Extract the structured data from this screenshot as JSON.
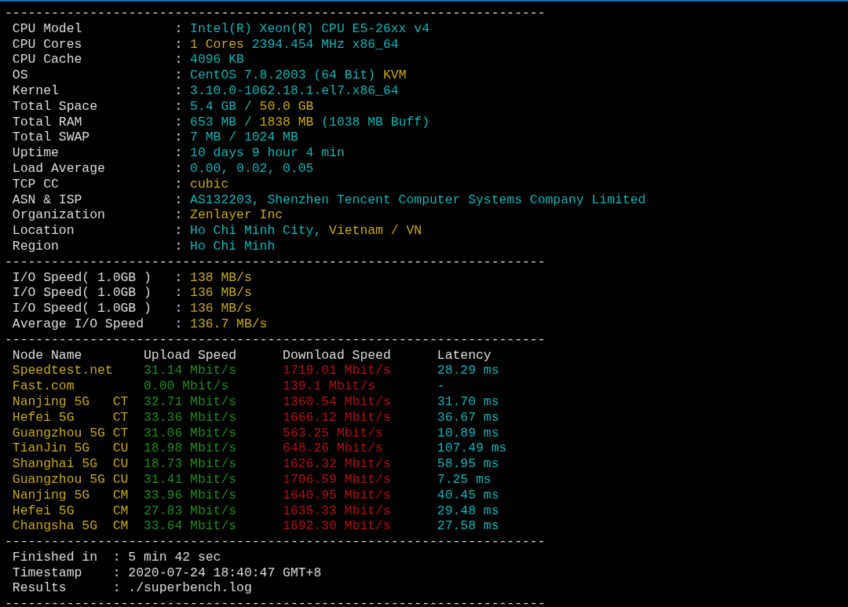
{
  "lines": [
    {
      "kind": "rule",
      "text": "----------------------------------------------------------------------"
    },
    {
      "kind": "field",
      "label": "CPU Model",
      "sep": ":",
      "parts": [
        {
          "text": "Intel(R) Xeon(R) CPU E5-26xx v4",
          "color": "#0fb3b8"
        }
      ]
    },
    {
      "kind": "field",
      "label": "CPU Cores",
      "sep": ":",
      "parts": [
        {
          "text": "1 Cores",
          "color": "#c8a80c"
        },
        {
          "text": "2394.454 MHz x86_64",
          "color": "#0fb3b8"
        }
      ]
    },
    {
      "kind": "field",
      "label": "CPU Cache",
      "sep": ":",
      "parts": [
        {
          "text": "4096 KB",
          "color": "#0fb3b8"
        }
      ]
    },
    {
      "kind": "field",
      "label": "OS",
      "sep": ":",
      "parts": [
        {
          "text": "CentOS 7.8.2003 (64 Bit)",
          "color": "#0fb3b8"
        },
        {
          "text": "KVM",
          "color": "#c8a80c"
        }
      ]
    },
    {
      "kind": "field",
      "label": "Kernel",
      "sep": ":",
      "parts": [
        {
          "text": "3.10.0-1062.18.1.el7.x86_64",
          "color": "#0fb3b8"
        }
      ]
    },
    {
      "kind": "field",
      "label": "Total Space",
      "sep": ":",
      "parts": [
        {
          "text": "5.4 GB /",
          "color": "#0fb3b8"
        },
        {
          "text": "50.0 GB",
          "color": "#c8a80c"
        }
      ]
    },
    {
      "kind": "field",
      "label": "Total RAM",
      "sep": ":",
      "parts": [
        {
          "text": "653 MB /",
          "color": "#0fb3b8"
        },
        {
          "text": "1838 MB",
          "color": "#c8a80c"
        },
        {
          "text": "(1038 MB Buff)",
          "color": "#0fb3b8"
        }
      ]
    },
    {
      "kind": "field",
      "label": "Total SWAP",
      "sep": ":",
      "parts": [
        {
          "text": "7 MB / 1024 MB",
          "color": "#0fb3b8"
        }
      ]
    },
    {
      "kind": "field",
      "label": "Uptime",
      "sep": ":",
      "parts": [
        {
          "text": "10 days 9 hour 4 min",
          "color": "#0fb3b8"
        }
      ]
    },
    {
      "kind": "field",
      "label": "Load Average",
      "sep": ":",
      "parts": [
        {
          "text": "0.00, 0.02, 0.05",
          "color": "#0fb3b8"
        }
      ]
    },
    {
      "kind": "field",
      "label": "TCP CC",
      "sep": ":",
      "parts": [
        {
          "text": "cubic",
          "color": "#c8a80c"
        }
      ]
    },
    {
      "kind": "field",
      "label": "ASN & ISP",
      "sep": ":",
      "parts": [
        {
          "text": "AS132203, Shenzhen Tencent Computer Systems Company Limited",
          "color": "#0fb3b8"
        }
      ]
    },
    {
      "kind": "field",
      "label": "Organization",
      "sep": ":",
      "parts": [
        {
          "text": "Zenlayer Inc",
          "color": "#c8a80c"
        }
      ]
    },
    {
      "kind": "field",
      "label": "Location",
      "sep": ":",
      "parts": [
        {
          "text": "Ho Chi Minh City,",
          "color": "#0fb3b8"
        },
        {
          "text": "Vietnam / VN",
          "color": "#c8a80c"
        }
      ]
    },
    {
      "kind": "field",
      "label": "Region",
      "sep": ":",
      "parts": [
        {
          "text": "Ho Chi Minh",
          "color": "#0fb3b8"
        }
      ]
    },
    {
      "kind": "rule",
      "text": "----------------------------------------------------------------------"
    },
    {
      "kind": "field",
      "label": "I/O Speed( 1.0GB )",
      "sep": ":",
      "parts": [
        {
          "text": "138 MB/s",
          "color": "#c8a80c"
        }
      ]
    },
    {
      "kind": "field",
      "label": "I/O Speed( 1.0GB )",
      "sep": ":",
      "parts": [
        {
          "text": "136 MB/s",
          "color": "#c8a80c"
        }
      ]
    },
    {
      "kind": "field",
      "label": "I/O Speed( 1.0GB )",
      "sep": ":",
      "parts": [
        {
          "text": "136 MB/s",
          "color": "#c8a80c"
        }
      ]
    },
    {
      "kind": "field",
      "label": "Average I/O Speed",
      "sep": ":",
      "parts": [
        {
          "text": "136.7 MB/s",
          "color": "#c8a80c"
        }
      ]
    },
    {
      "kind": "rule",
      "text": "----------------------------------------------------------------------"
    },
    {
      "kind": "header",
      "cells": [
        "Node Name",
        "Upload Speed",
        "Download Speed",
        "Latency"
      ]
    },
    {
      "kind": "speed",
      "cells": [
        "Speedtest.net",
        "31.14 Mbit/s",
        "1719.01 Mbit/s",
        "28.29 ms"
      ]
    },
    {
      "kind": "speed",
      "cells": [
        "Fast.com",
        "0.00 Mbit/s",
        "139.1 Mbit/s",
        "-"
      ]
    },
    {
      "kind": "speed",
      "cells": [
        "Nanjing 5G   CT",
        "32.71 Mbit/s",
        "1360.54 Mbit/s",
        "31.70 ms"
      ]
    },
    {
      "kind": "speed",
      "cells": [
        "Hefei 5G     CT",
        "33.36 Mbit/s",
        "1666.12 Mbit/s",
        "36.67 ms"
      ]
    },
    {
      "kind": "speed",
      "cells": [
        "Guangzhou 5G CT",
        "31.06 Mbit/s",
        "563.25 Mbit/s",
        "10.89 ms"
      ]
    },
    {
      "kind": "speed",
      "cells": [
        "TianJin 5G   CU",
        "18.98 Mbit/s",
        "648.26 Mbit/s",
        "107.49 ms"
      ]
    },
    {
      "kind": "speed",
      "cells": [
        "Shanghai 5G  CU",
        "18.73 Mbit/s",
        "1626.32 Mbit/s",
        "58.95 ms"
      ]
    },
    {
      "kind": "speed",
      "cells": [
        "Guangzhou 5G CU",
        "31.41 Mbit/s",
        "1706.59 Mbit/s",
        "7.25 ms"
      ]
    },
    {
      "kind": "speed",
      "cells": [
        "Nanjing 5G   CM",
        "33.96 Mbit/s",
        "1640.95 Mbit/s",
        "40.45 ms"
      ]
    },
    {
      "kind": "speed",
      "cells": [
        "Hefei 5G     CM",
        "27.83 Mbit/s",
        "1635.33 Mbit/s",
        "29.48 ms"
      ]
    },
    {
      "kind": "speed",
      "cells": [
        "Changsha 5G  CM",
        "33.64 Mbit/s",
        "1692.30 Mbit/s",
        "27.58 ms"
      ]
    },
    {
      "kind": "rule",
      "text": "----------------------------------------------------------------------"
    },
    {
      "kind": "summary",
      "label": "Finished in",
      "sep": ":",
      "parts": [
        {
          "text": "5 min 42 sec"
        }
      ]
    },
    {
      "kind": "summary",
      "label": "Timestamp",
      "sep": ":",
      "parts": [
        {
          "text": "2020-07-24 18:40:47 GMT+8"
        }
      ]
    },
    {
      "kind": "summary",
      "label": "Results",
      "sep": ":",
      "parts": [
        {
          "text": "./superbench.log"
        }
      ]
    },
    {
      "kind": "rule",
      "text": "----------------------------------------------------------------------"
    }
  ]
}
